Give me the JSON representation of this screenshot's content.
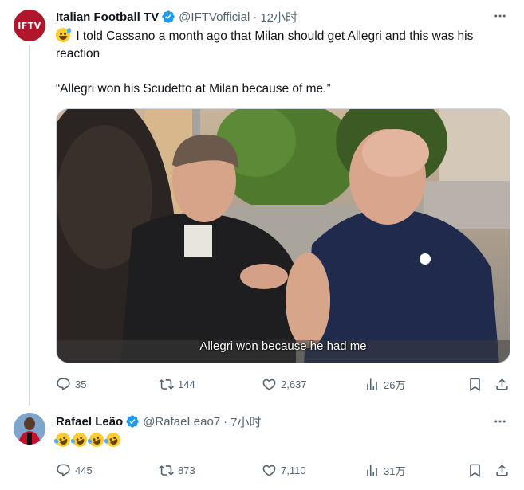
{
  "tweet1": {
    "avatar_text": "IFTV",
    "name": "Italian Football TV",
    "handle": "@IFTVofficial",
    "dot": "·",
    "time": "12小时",
    "text_line1": "I told Cassano a month ago that Milan should get Allegri and this was his reaction",
    "text_quote": "“Allegri won his Scudetto at Milan because of me.”",
    "video_caption": "Allegri won because he had me",
    "stats": {
      "replies": "35",
      "reposts": "144",
      "likes": "2,637",
      "views": "26万"
    }
  },
  "tweet2": {
    "name": "Rafael Leão",
    "handle": "@RafaeLeao7",
    "dot": "·",
    "time": "7小时",
    "stats": {
      "replies": "445",
      "reposts": "873",
      "likes": "7,110",
      "views": "31万"
    }
  },
  "icons": {
    "verified": "verified-badge-icon",
    "more": "more-icon",
    "reply": "reply-icon",
    "repost": "repost-icon",
    "like": "like-icon",
    "views": "views-icon",
    "bookmark": "bookmark-icon",
    "share": "share-icon",
    "emoji_sweat": "grinning-sweat-emoji",
    "emoji_rofl": "rolling-laughing-emoji"
  },
  "colors": {
    "text": "#0f1419",
    "secondary": "#536471",
    "verified": "#1d9bf0",
    "iftv_brand": "#b0172c"
  }
}
